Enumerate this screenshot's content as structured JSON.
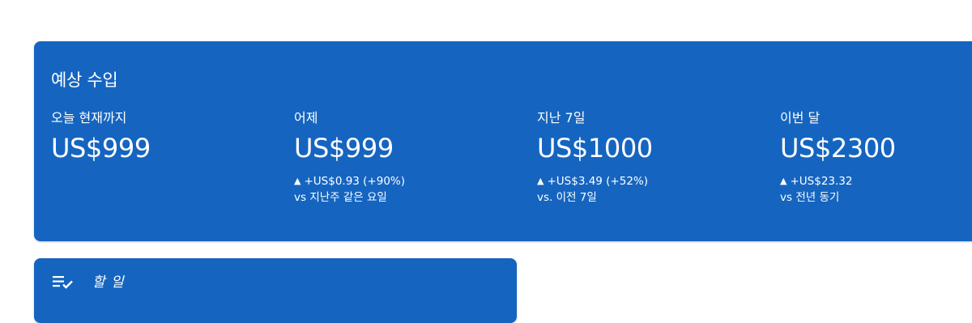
{
  "earnings": {
    "title": "예상 수입",
    "metrics": [
      {
        "label": "오늘 현재까지",
        "value": "US$999",
        "change": "",
        "compare": ""
      },
      {
        "label": "어제",
        "value": "US$999",
        "change": "+US$0.93 (+90%)",
        "compare": "vs 지난주 같은 요일"
      },
      {
        "label": "지난 7일",
        "value": "US$1000",
        "change": "+US$3.49 (+52%)",
        "compare": "vs. 이전 7일"
      },
      {
        "label": "이번 달",
        "value": "US$2300",
        "change": "+US$23.32",
        "compare": "vs 전년 동기"
      }
    ]
  },
  "todo": {
    "title": "할 일",
    "icon": "checklist-icon"
  },
  "colors": {
    "card_bg": "#1565c0",
    "text": "#ffffff"
  }
}
